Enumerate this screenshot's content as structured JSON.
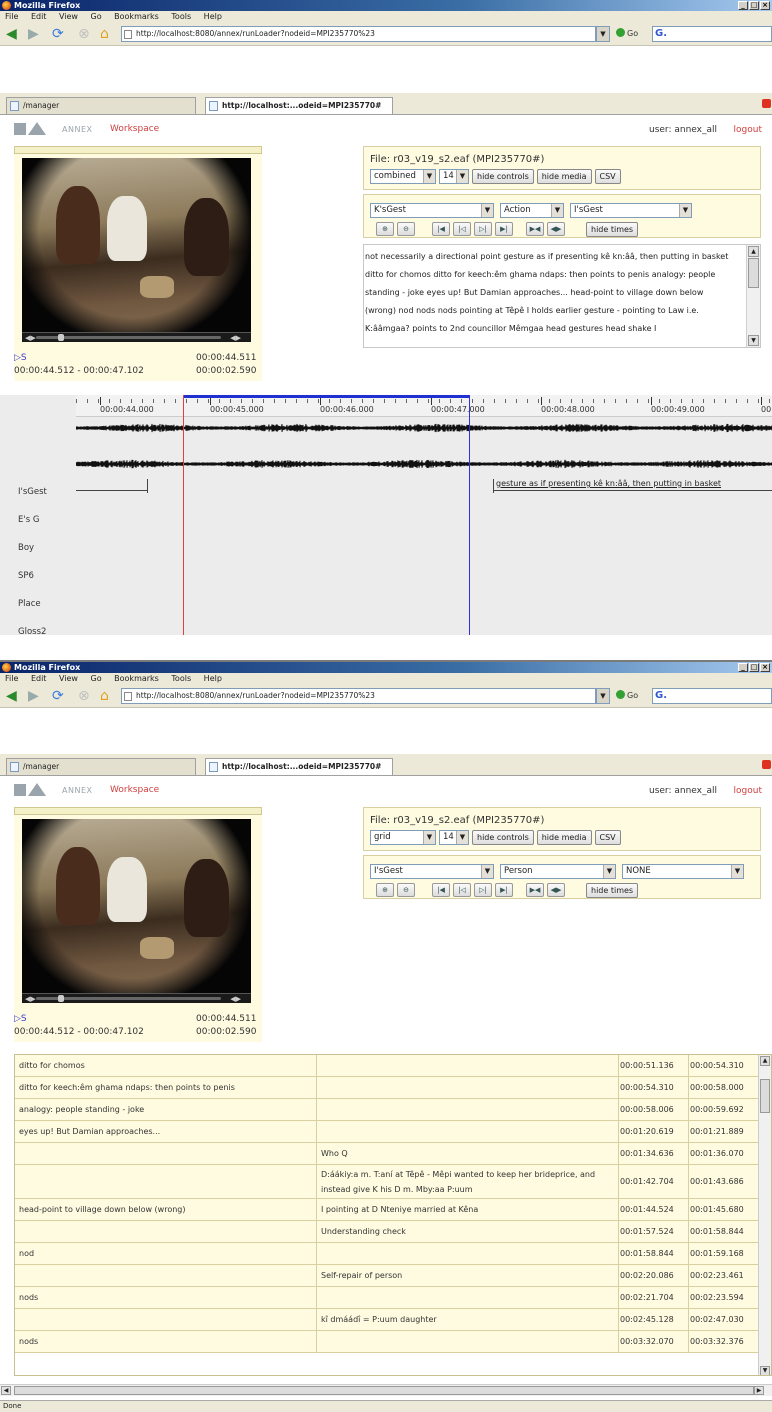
{
  "browser": {
    "title": "Mozilla Firefox",
    "menu": [
      "File",
      "Edit",
      "View",
      "Go",
      "Bookmarks",
      "Tools",
      "Help"
    ],
    "url": "http://localhost:8080/annex/runLoader?nodeid=MPI235770%23",
    "go_label": "Go",
    "search_text": "G.",
    "tabs": [
      {
        "label": "/manager"
      },
      {
        "label": "http://localhost:...odeid=MPI235770#"
      }
    ],
    "status": "Done"
  },
  "app": {
    "brand": "ANNEX",
    "workspace": "Workspace",
    "user": "user: annex_all",
    "logout": "logout",
    "media": {
      "marker": "▷S",
      "current_time": "00:00:44.511",
      "range": "00:00:44.512 - 00:00:47.102",
      "duration": "00:00:02.590"
    },
    "file_label": "File: r03_v19_s2.eaf (MPI235770#)",
    "buttons": {
      "hide_controls": "hide controls",
      "hide_media": "hide media",
      "csv": "CSV",
      "hide_times": "hide times"
    }
  },
  "window1": {
    "view_mode": "combined",
    "font_size": "14",
    "tier_select": "K'sGest",
    "type_select": "Action",
    "tier2_select": "I'sGest",
    "annotation_text": "not necessarily a directional point  gesture as if presenting kê kn:ââ, then putting in basket  ditto for chomos  ditto for keech:êm ghama ndaps: then points to penis  analogy: people standing - joke  eyes up! But Damian approaches...  head-point to village down below (wrong)  nod  nods  nods  pointing at Têpê  I holds earlier gesture - pointing to Law i.e. K:ââmgaa?  points to 2nd councillor Mêmgaa  head gestures  head shake  I",
    "ruler_ticks": [
      "00:00:44.000",
      "00:00:45.000",
      "00:00:46.000",
      "00:00:47.000",
      "00:00:48.000",
      "00:00:49.000",
      "00"
    ],
    "tiers": [
      "I'sGest",
      "E's G",
      "Boy",
      "SP6",
      "Place",
      "Gloss2"
    ],
    "timeline_annotation": "gesture as if presenting kê kn:ââ, then putting in basket"
  },
  "window2": {
    "view_mode": "grid",
    "font_size": "14",
    "tier_select": "I'sGest",
    "type_select": "Person",
    "tier2_select": "NONE",
    "rows": [
      {
        "c1": "ditto for chomos",
        "c2": "",
        "start": "00:00:51.136",
        "end": "00:00:54.310"
      },
      {
        "c1": "ditto for keech:êm ghama ndaps: then points to penis",
        "c2": "",
        "start": "00:00:54.310",
        "end": "00:00:58.000"
      },
      {
        "c1": "analogy: people standing - joke",
        "c2": "",
        "start": "00:00:58.006",
        "end": "00:00:59.692"
      },
      {
        "c1": "eyes up! But Damian approaches...",
        "c2": "",
        "start": "00:01:20.619",
        "end": "00:01:21.889"
      },
      {
        "c1": "",
        "c2": "Who Q",
        "start": "00:01:34.636",
        "end": "00:01:36.070"
      },
      {
        "c1": "",
        "c2": "D:áákiy:a m. T:aní at Têpê - Mêpi wanted to keep her brideprice, and instead give K his D m. Mby:aa P:uum",
        "start": "00:01:42.704",
        "end": "00:01:43.686"
      },
      {
        "c1": "head-point to village down below (wrong)",
        "c2": "I pointing at D Nteniye married at Kêna",
        "start": "00:01:44.524",
        "end": "00:01:45.680"
      },
      {
        "c1": "",
        "c2": "Understanding check",
        "start": "00:01:57.524",
        "end": "00:01:58.844"
      },
      {
        "c1": "nod",
        "c2": "",
        "start": "00:01:58.844",
        "end": "00:01:59.168"
      },
      {
        "c1": "",
        "c2": "Self-repair of person",
        "start": "00:02:20.086",
        "end": "00:02:23.461"
      },
      {
        "c1": "nods",
        "c2": "",
        "start": "00:02:21.704",
        "end": "00:02:23.594"
      },
      {
        "c1": "",
        "c2": "kî dmáádî = P:uum daughter",
        "start": "00:02:45.128",
        "end": "00:02:47.030"
      },
      {
        "c1": "nods",
        "c2": "",
        "start": "00:03:32.070",
        "end": "00:03:32.376"
      }
    ]
  }
}
